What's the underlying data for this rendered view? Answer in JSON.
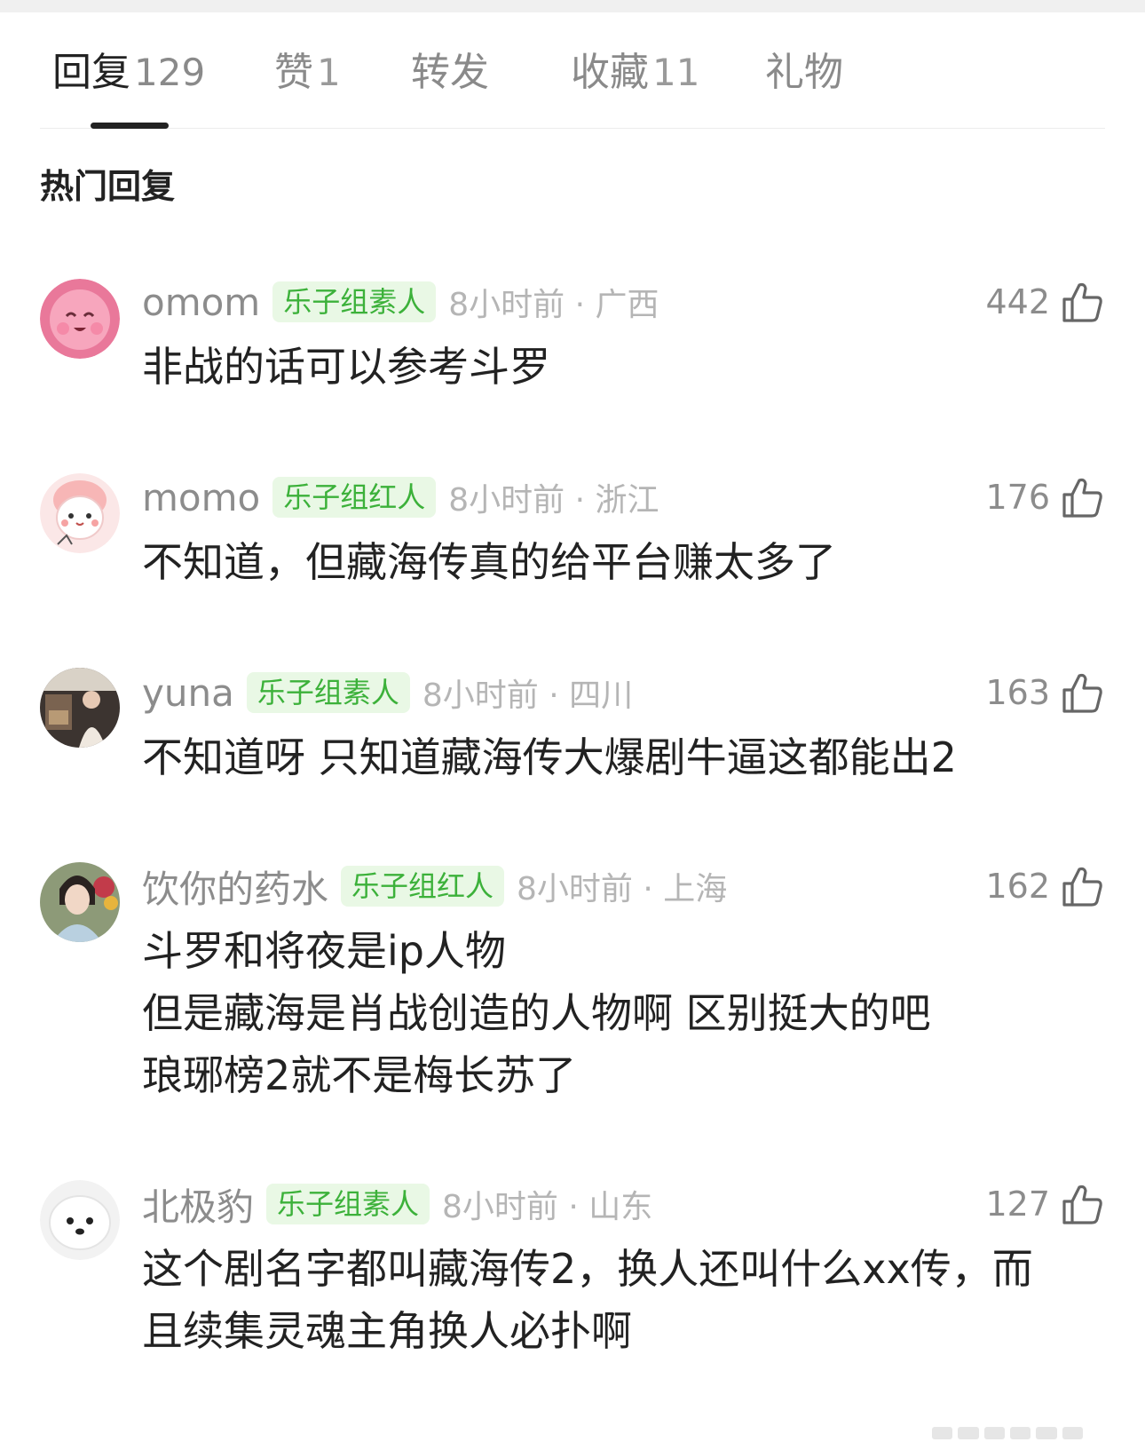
{
  "tabs": [
    {
      "label": "回复",
      "count": "129"
    },
    {
      "label": "赞",
      "count": "1"
    },
    {
      "label": "转发",
      "count": ""
    },
    {
      "label": "收藏",
      "count": "11"
    },
    {
      "label": "礼物",
      "count": ""
    }
  ],
  "section_title": "热门回复",
  "comments": [
    {
      "username": "omom",
      "tag": "乐子组素人",
      "time": "8小时前 · 广西",
      "likes": "442",
      "lines": [
        "非战的话可以参考斗罗"
      ]
    },
    {
      "username": "momo",
      "tag": "乐子组红人",
      "time": "8小时前 · 浙江",
      "likes": "176",
      "lines": [
        "不知道，但藏海传真的给平台赚太多了"
      ]
    },
    {
      "username": "yuna",
      "tag": "乐子组素人",
      "time": "8小时前 · 四川",
      "likes": "163",
      "lines": [
        "不知道呀 只知道藏海传大爆剧牛逼这都能出2"
      ]
    },
    {
      "username": "饮你的药水",
      "tag": "乐子组红人",
      "time": "8小时前 · 上海",
      "likes": "162",
      "lines": [
        "斗罗和将夜是ip人物",
        "但是藏海是肖战创造的人物啊 区别挺大的吧",
        "琅琊榜2就不是梅长苏了"
      ]
    },
    {
      "username": "北极豹",
      "tag": "乐子组素人",
      "time": "8小时前 · 山东",
      "likes": "127",
      "lines": [
        "这个剧名字都叫藏海传2，换人还叫什么xx传，而",
        "且续集灵魂主角换人必扑啊"
      ]
    }
  ]
}
